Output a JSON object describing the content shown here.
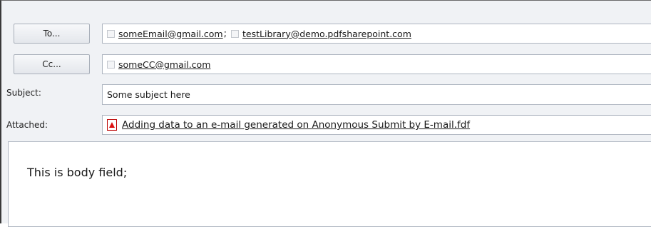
{
  "to_button": "To...",
  "cc_button": "Cc...",
  "to_recipients": [
    "someEmail@gmail.com",
    "testLibrary@demo.pdfsharepoint.com"
  ],
  "separator": ";",
  "cc_recipients": [
    "someCC@gmail.com"
  ],
  "subject_label": "Subject:",
  "subject_value": "Some subject here",
  "attached_label": "Attached:",
  "attachment_name": "Adding data to an e-mail generated on Anonymous Submit by E-mail.fdf",
  "body_text": "This is body field;",
  "icons": {
    "attachment": "pdf-file-icon",
    "recipient": "checkbox-icon"
  }
}
